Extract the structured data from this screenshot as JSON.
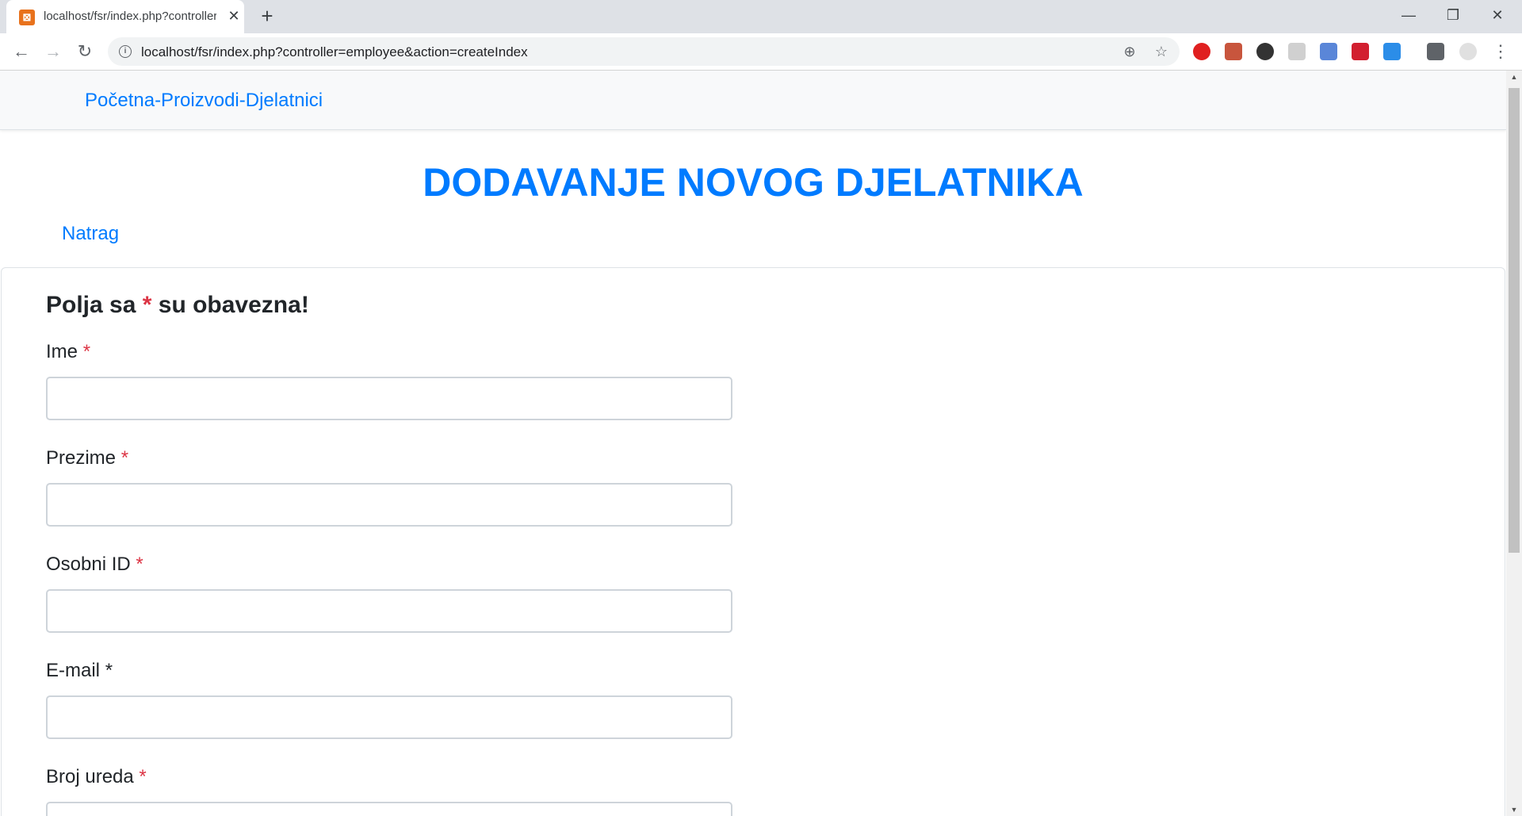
{
  "browser": {
    "tab_title": "localhost/fsr/index.php?controller=employee&action=createIndex",
    "url": "localhost/fsr/index.php?controller=employee&action=createIndex",
    "favicon": "xampp-icon",
    "tab_close": "✕",
    "new_tab": "+",
    "window_controls": {
      "minimize": "—",
      "maximize": "❐",
      "close": "✕"
    },
    "nav": {
      "back": "←",
      "forward": "→",
      "reload": "↻"
    },
    "info": "i",
    "omni_icons": {
      "zoom": "⊕",
      "bookmark": "☆"
    },
    "menu": "⋮",
    "extensions": [
      {
        "name": "adblock-icon",
        "color": "#e02020"
      },
      {
        "name": "pdf-icon",
        "color": "#c8553d"
      },
      {
        "name": "privacy-icon",
        "color": "#333333"
      },
      {
        "name": "blank-extension-icon",
        "color": "#d0d0d0"
      },
      {
        "name": "swirl-extension-icon",
        "color": "#5a86d8"
      },
      {
        "name": "media-extension-icon",
        "color": "#d21f2f"
      },
      {
        "name": "download-icon",
        "color": "#2b8de8"
      },
      {
        "name": "media-queue-icon",
        "color": "#5f6368"
      },
      {
        "name": "profile-avatar-icon",
        "color": "#e0e0e0"
      }
    ]
  },
  "navbar": {
    "link": "Početna-Proizvodi-Djelatnici"
  },
  "page": {
    "heading": "DODAVANJE NOVOG DJELATNIKA",
    "back_link": "Natrag",
    "form": {
      "title_prefix": "Polja sa ",
      "title_star": "*",
      "title_suffix": " su obavezna!",
      "fields": [
        {
          "label": "Ime",
          "star": "*",
          "star_color": "#dc3545",
          "value": ""
        },
        {
          "label": "Prezime",
          "star": "*",
          "star_color": "#dc3545",
          "value": ""
        },
        {
          "label": "Osobni ID",
          "star": "*",
          "star_color": "#dc3545",
          "value": ""
        },
        {
          "label": "E-mail",
          "star": "*",
          "star_color": "#212529",
          "value": ""
        },
        {
          "label": "Broj ureda",
          "star": "*",
          "star_color": "#dc3545",
          "value": ""
        }
      ]
    }
  },
  "colors": {
    "link": "#007bff",
    "required": "#dc3545",
    "text": "#212529"
  }
}
